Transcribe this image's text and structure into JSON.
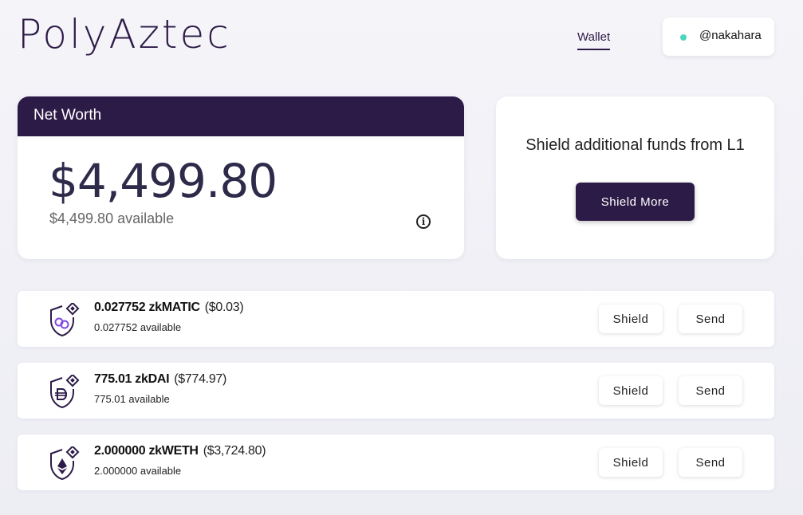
{
  "brand": {
    "logo": "PolyAztec"
  },
  "nav": {
    "wallet": "Wallet"
  },
  "user": {
    "handle": "@nakahara"
  },
  "net_worth": {
    "title": "Net Worth",
    "amount": "$4,499.80",
    "available": "$4,499.80 available"
  },
  "shield_card": {
    "text": "Shield additional funds from L1",
    "button": "Shield More"
  },
  "tokens": [
    {
      "amount": "0.027752 zkMATIC",
      "usd": "($0.03)",
      "available": "0.027752 available",
      "icon": "matic-shield-icon",
      "shield": "Shield",
      "send": "Send"
    },
    {
      "amount": "775.01 zkDAI",
      "usd": "($774.97)",
      "available": "775.01 available",
      "icon": "dai-shield-icon",
      "shield": "Shield",
      "send": "Send"
    },
    {
      "amount": "2.000000 zkWETH",
      "usd": "($3,724.80)",
      "available": "2.000000 available",
      "icon": "eth-shield-icon",
      "shield": "Shield",
      "send": "Send"
    }
  ],
  "colors": {
    "primary": "#2d1b47",
    "status_dot": "#4ed6c0",
    "matic": "#8247e5"
  }
}
